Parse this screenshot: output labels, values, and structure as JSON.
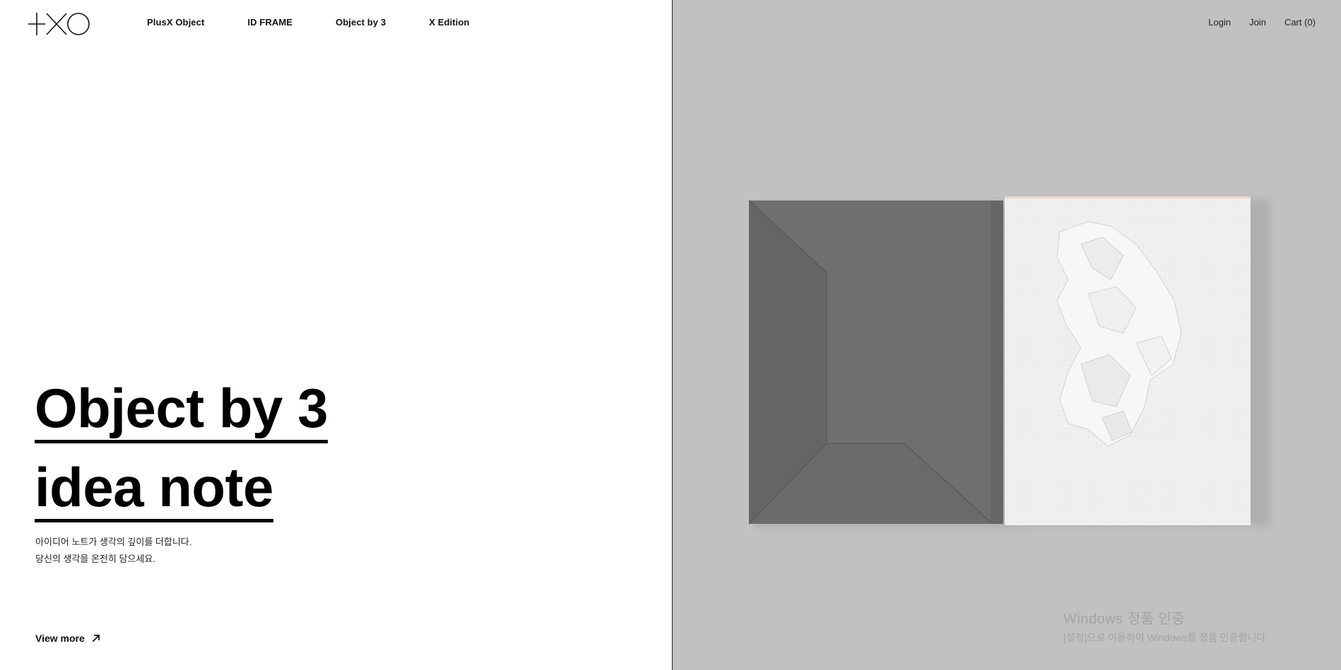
{
  "brand": {
    "logo_text": "+XO"
  },
  "nav": {
    "items": [
      {
        "label": "PlusX Object"
      },
      {
        "label": "ID FRAME"
      },
      {
        "label": "Object by 3"
      },
      {
        "label": "X Edition"
      }
    ]
  },
  "utility": {
    "login": "Login",
    "join": "Join",
    "cart": "Cart (0)"
  },
  "hero": {
    "title_line1": "Object by 3",
    "title_line2": "idea note",
    "desc_line1": "아이디어 노트가 생각의 깊이를 더합니다.",
    "desc_line2": "당신의 생각을 온전히 담으세요.",
    "cta": "View more"
  },
  "watermark": {
    "title": "Windows 정품 인증",
    "subtitle": "[설정]으로 이동하여 Windows를 정품 인증합니다."
  },
  "colors": {
    "right_bg": "#c1c1c1",
    "folder": "#6e6e6e",
    "paper": "#efefef"
  },
  "icons": {
    "cta_arrow": "arrow-up-right-icon",
    "logo": "plusxo-logo"
  }
}
